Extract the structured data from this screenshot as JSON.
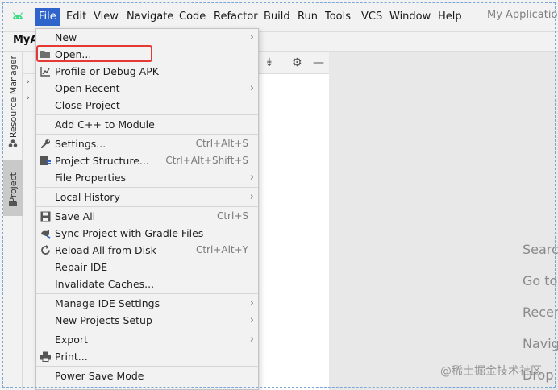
{
  "menubar": {
    "items": [
      "File",
      "Edit",
      "View",
      "Navigate",
      "Code",
      "Refactor",
      "Build",
      "Run",
      "Tools",
      "VCS",
      "Window",
      "Help"
    ],
    "app_title": "My Application"
  },
  "project_name": "MyA",
  "tool_stripe": {
    "resource_manager": "Resource Manager",
    "project": "Project"
  },
  "editor_hints": [
    "Search",
    "Go to",
    "Recen",
    "Navig",
    "Drop"
  ],
  "file_menu": {
    "items": [
      {
        "label": "New",
        "shortcut": "",
        "submenu": true,
        "icon": ""
      },
      {
        "label": "Open...",
        "shortcut": "",
        "submenu": false,
        "icon": "folder-icon"
      },
      {
        "label": "Profile or Debug APK",
        "shortcut": "",
        "submenu": false,
        "icon": "profile-chart-icon"
      },
      {
        "label": "Open Recent",
        "shortcut": "",
        "submenu": true,
        "icon": ""
      },
      {
        "label": "Close Project",
        "shortcut": "",
        "submenu": false,
        "icon": ""
      },
      {
        "label": "Add C++ to Module",
        "shortcut": "",
        "submenu": false,
        "icon": ""
      },
      {
        "label": "Settings...",
        "shortcut": "Ctrl+Alt+S",
        "submenu": false,
        "icon": "wrench-icon"
      },
      {
        "label": "Project Structure...",
        "shortcut": "Ctrl+Alt+Shift+S",
        "submenu": false,
        "icon": "project-structure-icon"
      },
      {
        "label": "File Properties",
        "shortcut": "",
        "submenu": true,
        "icon": ""
      },
      {
        "label": "Local History",
        "shortcut": "",
        "submenu": true,
        "icon": ""
      },
      {
        "label": "Save All",
        "shortcut": "Ctrl+S",
        "submenu": false,
        "icon": "save-icon"
      },
      {
        "label": "Sync Project with Gradle Files",
        "shortcut": "",
        "submenu": false,
        "icon": "gradle-sync-icon"
      },
      {
        "label": "Reload All from Disk",
        "shortcut": "Ctrl+Alt+Y",
        "submenu": false,
        "icon": "reload-icon"
      },
      {
        "label": "Repair IDE",
        "shortcut": "",
        "submenu": false,
        "icon": ""
      },
      {
        "label": "Invalidate Caches...",
        "shortcut": "",
        "submenu": false,
        "icon": ""
      },
      {
        "label": "Manage IDE Settings",
        "shortcut": "",
        "submenu": true,
        "icon": ""
      },
      {
        "label": "New Projects Setup",
        "shortcut": "",
        "submenu": true,
        "icon": ""
      },
      {
        "label": "Export",
        "shortcut": "",
        "submenu": true,
        "icon": ""
      },
      {
        "label": "Print...",
        "shortcut": "",
        "submenu": false,
        "icon": "printer-icon"
      },
      {
        "label": "Power Save Mode",
        "shortcut": "",
        "submenu": false,
        "icon": ""
      }
    ],
    "submenu_glyph": "›"
  },
  "watermark": "@稀土掘金技术社区",
  "colors": {
    "menu_active": "#2f65ca",
    "highlight_box": "#e53935",
    "android_green": "#3ddc84"
  }
}
